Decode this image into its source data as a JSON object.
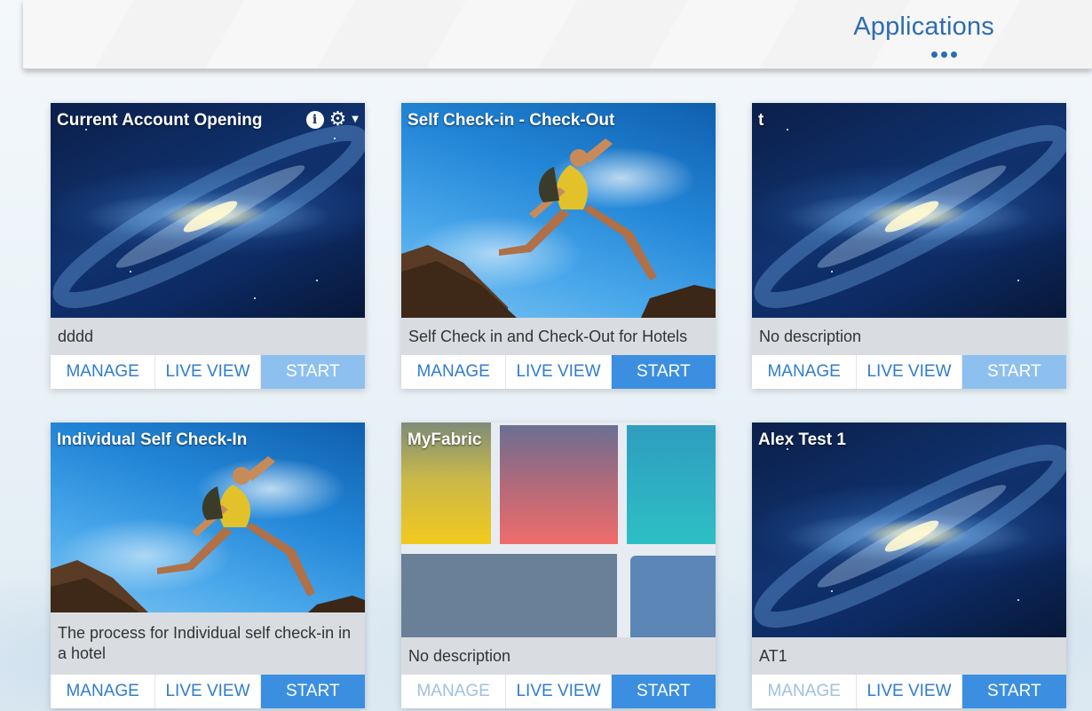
{
  "header": {
    "title": "Applications",
    "menu_icon": "ellipsis-icon"
  },
  "colors": {
    "accent": "#2d6db3",
    "start_button": "#3c8fe0",
    "start_button_light": "#8ec0ef",
    "link_text": "#2f7cd0"
  },
  "cards": [
    {
      "title": "Current Account Opening",
      "image": "galaxy",
      "description": "dddd",
      "icons": [
        "info-icon",
        "gear-icon",
        "caret-down-icon"
      ],
      "manage": "MANAGE",
      "live_view": "LIVE VIEW",
      "start": "START"
    },
    {
      "title": "Self Check-in - Check-Out",
      "image": "jumper",
      "description": "Self Check in and Check-Out for Hotels",
      "manage": "MANAGE",
      "live_view": "LIVE VIEW",
      "start": "START"
    },
    {
      "title": "t",
      "image": "galaxy",
      "description": "No description",
      "manage": "MANAGE",
      "live_view": "LIVE VIEW",
      "start": "START"
    },
    {
      "title": "Individual Self Check-In",
      "image": "jumper",
      "description": "The process for Individual self check-in in a hotel",
      "manage": "MANAGE",
      "live_view": "LIVE VIEW",
      "start": "START"
    },
    {
      "title": "MyFabric",
      "image": "fabric",
      "description": "No description",
      "manage": "MANAGE",
      "live_view": "LIVE VIEW",
      "start": "START"
    },
    {
      "title": "Alex Test 1",
      "image": "galaxy",
      "description": "AT1",
      "manage": "MANAGE",
      "live_view": "LIVE VIEW",
      "start": "START"
    }
  ]
}
